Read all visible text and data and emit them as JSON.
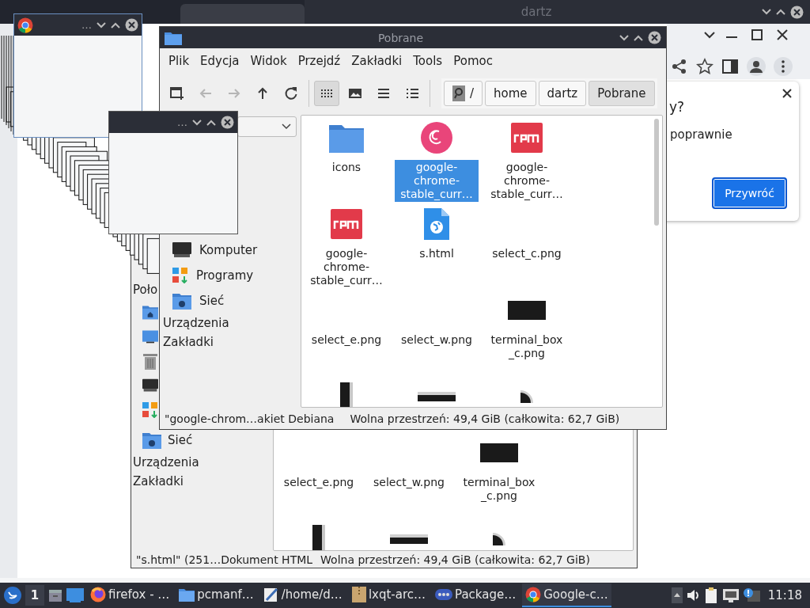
{
  "browser": {
    "window_title": "dartz",
    "dialog": {
      "heading": "y?",
      "text": "poprawnie",
      "button": "Przywróć"
    }
  },
  "mini_windows": [
    {
      "kind": "chrome",
      "title": "…"
    },
    {
      "kind": "plain",
      "title": "…"
    }
  ],
  "back_file_manager": {
    "sidebar_heading": "Poło",
    "places": [
      {
        "kind": "home"
      },
      {
        "kind": "desktop"
      },
      {
        "kind": "trash"
      },
      {
        "kind": "computer"
      },
      {
        "kind": "apps"
      },
      {
        "kind": "network",
        "label": "Sieć"
      }
    ],
    "sections": [
      "Urządzenia",
      "Zakładki"
    ],
    "files": [
      {
        "name": "select_e.png",
        "kind": "blank",
        "selected": false
      },
      {
        "name": "select_w.png",
        "kind": "blank",
        "selected": false
      },
      {
        "name": "terminal_box\n_c.png",
        "kind": "box",
        "selected": false
      },
      {
        "kind": "bar-v",
        "selected": false
      },
      {
        "kind": "bar-h",
        "selected": false
      },
      {
        "kind": "corner",
        "selected": false
      }
    ],
    "status": [
      "\"s.html\" (251…Dokument HTML",
      "Wolna przestrzeń: 49,4 GiB (całkowita: 62,7 GiB)"
    ]
  },
  "file_manager": {
    "title": "Pobrane",
    "menu": [
      "Plik",
      "Edycja",
      "Widok",
      "Przejdź",
      "Zakładki",
      "Tools",
      "Pomoc"
    ],
    "toolbar": [
      {
        "kind": "new-window",
        "disabled": false,
        "selected": false
      },
      {
        "kind": "back",
        "disabled": true,
        "selected": false
      },
      {
        "kind": "forward",
        "disabled": true,
        "selected": false
      },
      {
        "kind": "up",
        "disabled": false,
        "selected": false
      },
      {
        "kind": "reload",
        "disabled": false,
        "selected": false
      },
      {
        "kind": "icon-view",
        "disabled": false,
        "selected": true
      },
      {
        "kind": "thumbnail-view",
        "disabled": false,
        "selected": false
      },
      {
        "kind": "compact-view",
        "disabled": false,
        "selected": false
      },
      {
        "kind": "list-view",
        "disabled": false,
        "selected": false
      }
    ],
    "path": [
      {
        "label": "/",
        "selected": false
      },
      {
        "label": "home",
        "selected": false
      },
      {
        "label": "dartz",
        "selected": false
      },
      {
        "label": "Pobrane",
        "selected": true
      }
    ],
    "places": [
      {
        "kind": "computer",
        "label": "Komputer"
      },
      {
        "kind": "apps",
        "label": "Programy"
      },
      {
        "kind": "network",
        "label": "Sieć"
      }
    ],
    "sections": [
      "Urządzenia",
      "Zakładki"
    ],
    "files": [
      {
        "name": "icons",
        "kind": "folder",
        "selected": false
      },
      {
        "name": "google-chrome-stable_curr…",
        "kind": "debian",
        "selected": true
      },
      {
        "name": "google-chrome-stable_curr…",
        "kind": "rpm",
        "selected": false
      },
      {
        "name": "google-chrome-stable_curr…",
        "kind": "rpm",
        "selected": false
      },
      {
        "name": "s.html",
        "kind": "web",
        "selected": false
      },
      {
        "name": "select_c.png",
        "kind": "blank",
        "selected": false
      },
      {
        "name": "select_e.png",
        "kind": "blank",
        "selected": false
      },
      {
        "name": "select_w.png",
        "kind": "blank",
        "selected": false
      },
      {
        "name": "terminal_box\n_c.png",
        "kind": "box",
        "selected": false
      },
      {
        "kind": "bar-v",
        "selected": false
      },
      {
        "kind": "bar-h",
        "selected": false
      },
      {
        "kind": "corner",
        "selected": false
      }
    ],
    "status": [
      "\"google-chrom…akiet Debiana",
      "Wolna przestrzeń: 49,4 GiB (całkowita: 62,7 GiB)"
    ]
  },
  "taskbar": {
    "desktop": "1",
    "tasks": [
      {
        "kind": "firefox",
        "label": "firefox - …",
        "selected": false
      },
      {
        "kind": "folder",
        "label": "pcmanf…",
        "selected": false
      },
      {
        "kind": "editor",
        "label": "/home/d…",
        "selected": false
      },
      {
        "kind": "archive",
        "label": "lxqt-arc…",
        "selected": false
      },
      {
        "kind": "dots",
        "label": "Package…",
        "selected": false
      },
      {
        "kind": "chrome",
        "label": "Google-c…",
        "selected": true
      }
    ],
    "clock": "11:18"
  }
}
